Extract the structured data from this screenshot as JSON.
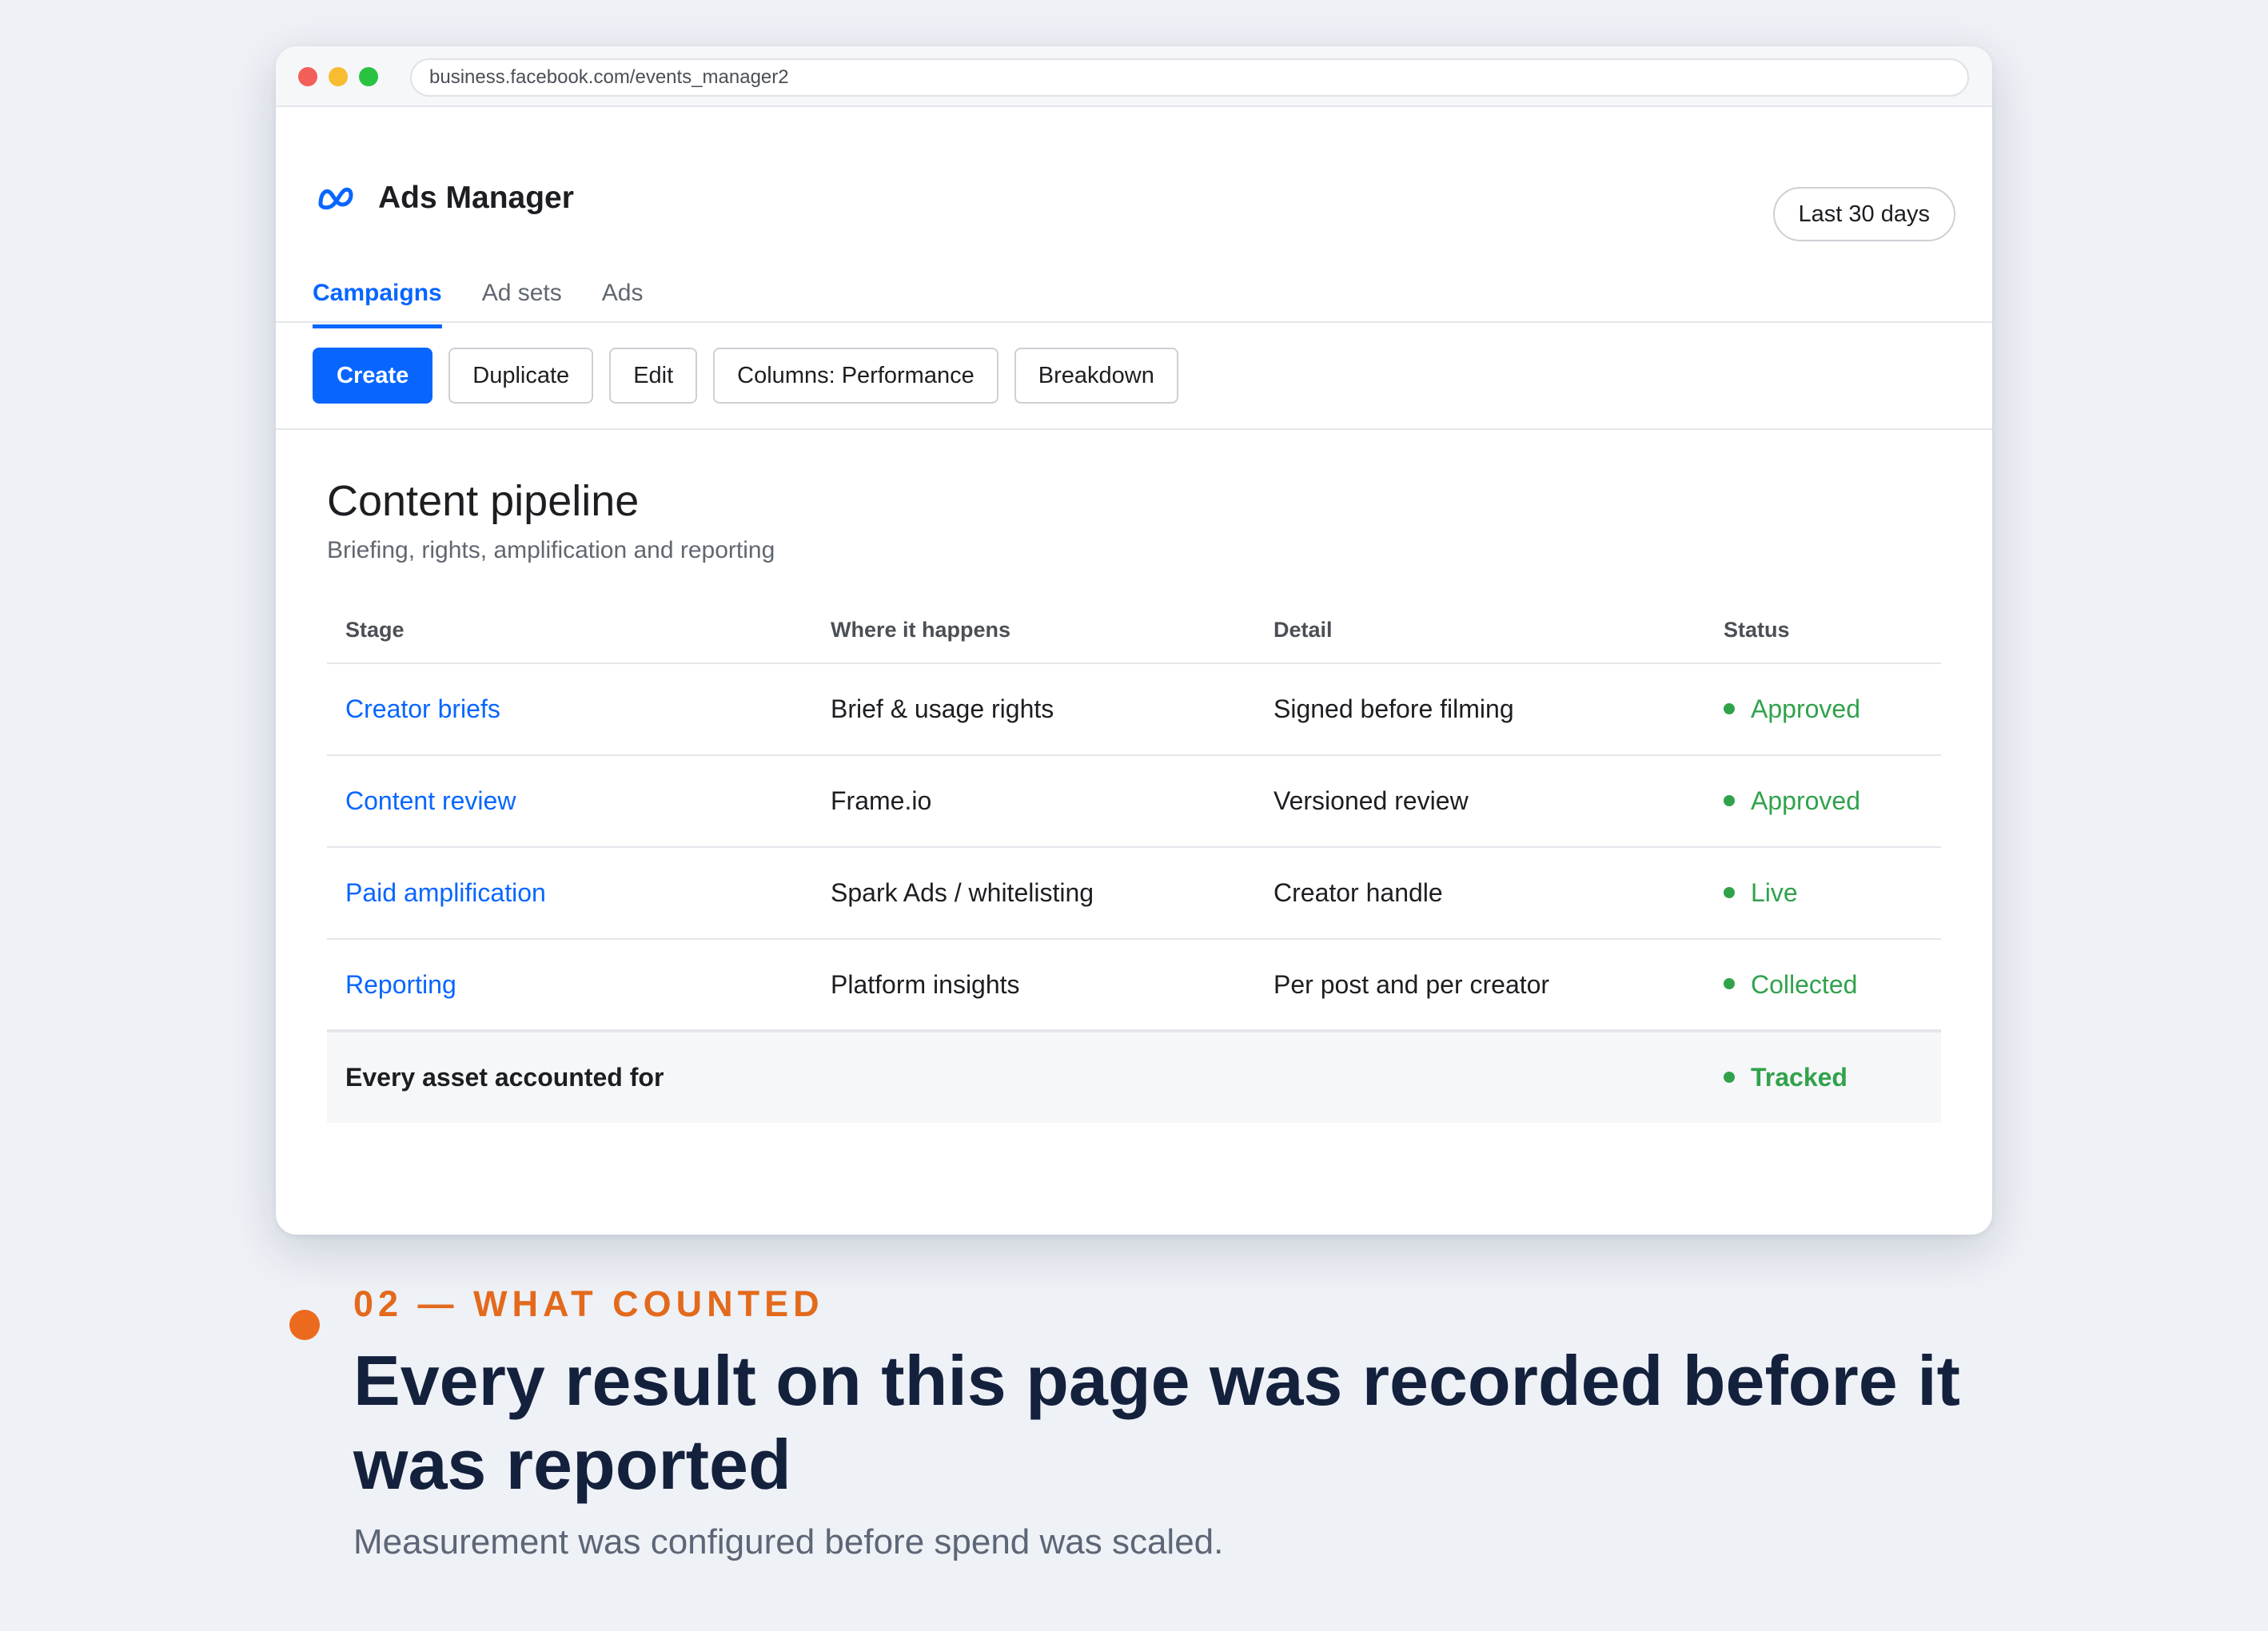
{
  "browser": {
    "url": "business.facebook.com/events_manager2"
  },
  "app": {
    "title": "Ads Manager",
    "date_range": "Last 30 days"
  },
  "tabs": [
    {
      "label": "Campaigns",
      "active": true
    },
    {
      "label": "Ad sets",
      "active": false
    },
    {
      "label": "Ads",
      "active": false
    }
  ],
  "toolbar": {
    "create": "Create",
    "duplicate": "Duplicate",
    "edit": "Edit",
    "columns": "Columns: Performance",
    "breakdown": "Breakdown"
  },
  "content": {
    "title": "Content pipeline",
    "subtitle": "Briefing, rights, amplification and reporting"
  },
  "table": {
    "headers": [
      "Stage",
      "Where it happens",
      "Detail",
      "Status"
    ],
    "rows": [
      {
        "stage": "Creator briefs",
        "where": "Brief & usage rights",
        "detail": "Signed before filming",
        "status": "Approved"
      },
      {
        "stage": "Content review",
        "where": "Frame.io",
        "detail": "Versioned review",
        "status": "Approved"
      },
      {
        "stage": "Paid amplification",
        "where": "Spark Ads / whitelisting",
        "detail": "Creator handle",
        "status": "Live"
      },
      {
        "stage": "Reporting",
        "where": "Platform insights",
        "detail": "Per post and per creator",
        "status": "Collected"
      }
    ],
    "summary": {
      "label": "Every asset accounted for",
      "status": "Tracked"
    }
  },
  "caption": {
    "eyebrow": "02 — WHAT COUNTED",
    "headline": "Every result on this page was recorded before it was reported",
    "subline": "Measurement was configured before spend was scaled."
  },
  "colors": {
    "accent": "#0866ff",
    "status_green": "#31a24c",
    "eyebrow_orange": "#e36a1c",
    "headline_navy": "#14213d"
  },
  "icons": {
    "logo": "meta-logo-icon"
  }
}
